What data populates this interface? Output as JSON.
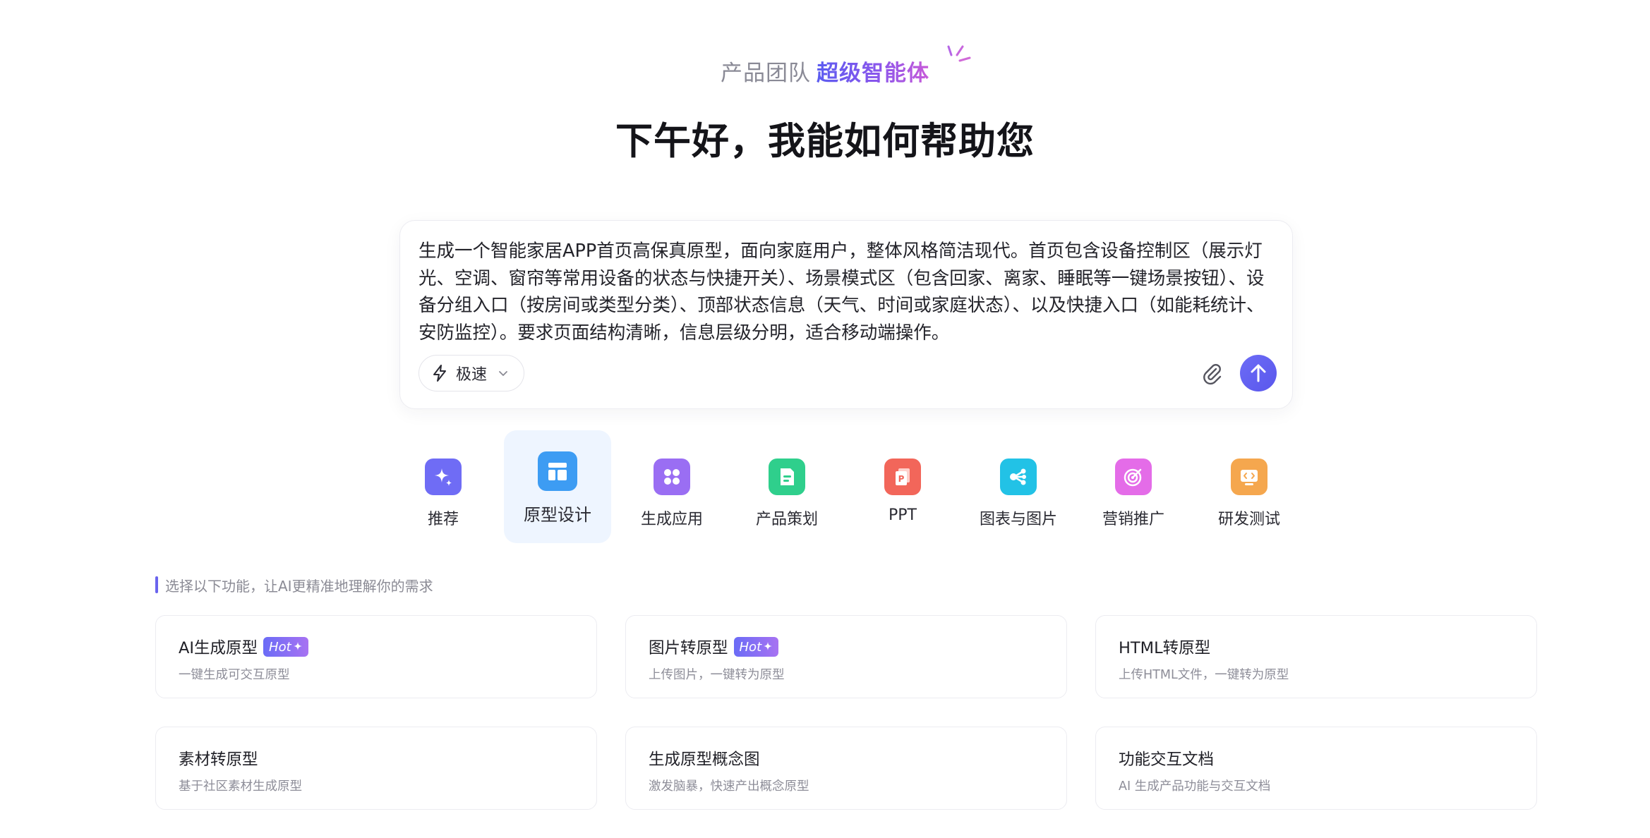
{
  "header": {
    "brand_team": "产品团队",
    "brand_agent": "超级智能体",
    "greeting": "下午好，我能如何帮助您"
  },
  "prompt": {
    "text": "生成一个智能家居APP首页高保真原型，面向家庭用户，整体风格简洁现代。首页包含设备控制区（展示灯光、空调、窗帘等常用设备的状态与快捷开关）、场景模式区（包含回家、离家、睡眠等一键场景按钮）、设备分组入口（按房间或类型分类）、顶部状态信息（天气、时间或家庭状态）、以及快捷入口（如能耗统计、安防监控）。要求页面结构清晰，信息层级分明，适合移动端操作。",
    "mode_label": "极速",
    "mode_icon": "lightning-icon",
    "attach_icon": "paperclip-icon",
    "send_icon": "arrow-up-icon"
  },
  "categories": [
    {
      "label": "推荐",
      "icon": "sparkle-icon",
      "color": "#6f6cf5"
    },
    {
      "label": "原型设计",
      "icon": "layout-icon",
      "color": "#3d9cf3",
      "active": true
    },
    {
      "label": "生成应用",
      "icon": "apps-grid-icon",
      "color": "#9a6ef3"
    },
    {
      "label": "产品策划",
      "icon": "document-icon",
      "color": "#2fcf8c"
    },
    {
      "label": "PPT",
      "icon": "ppt-icon",
      "color": "#f2665a"
    },
    {
      "label": "图表与图片",
      "icon": "share-nodes-icon",
      "color": "#22c2e6"
    },
    {
      "label": "营销推广",
      "icon": "target-icon",
      "color": "#e46ce8"
    },
    {
      "label": "研发测试",
      "icon": "code-screen-icon",
      "color": "#f5a74e"
    }
  ],
  "section": {
    "hint": "选择以下功能，让AI更精准地理解你的需求"
  },
  "cards": [
    {
      "title": "AI生成原型",
      "subtitle": "一键生成可交互原型",
      "badge": "Hot"
    },
    {
      "title": "图片转原型",
      "subtitle": "上传图片，一键转为原型",
      "badge": "Hot"
    },
    {
      "title": "HTML转原型",
      "subtitle": "上传HTML文件，一键转为原型"
    },
    {
      "title": "素材转原型",
      "subtitle": "基于社区素材生成原型"
    },
    {
      "title": "生成原型概念图",
      "subtitle": "激发脑暴，快速产出概念原型"
    },
    {
      "title": "功能交互文档",
      "subtitle": "AI 生成产品功能与交互文档"
    }
  ],
  "colors": {
    "accent": "#5b5cf0",
    "active_tab_bg": "#eef5ff"
  }
}
